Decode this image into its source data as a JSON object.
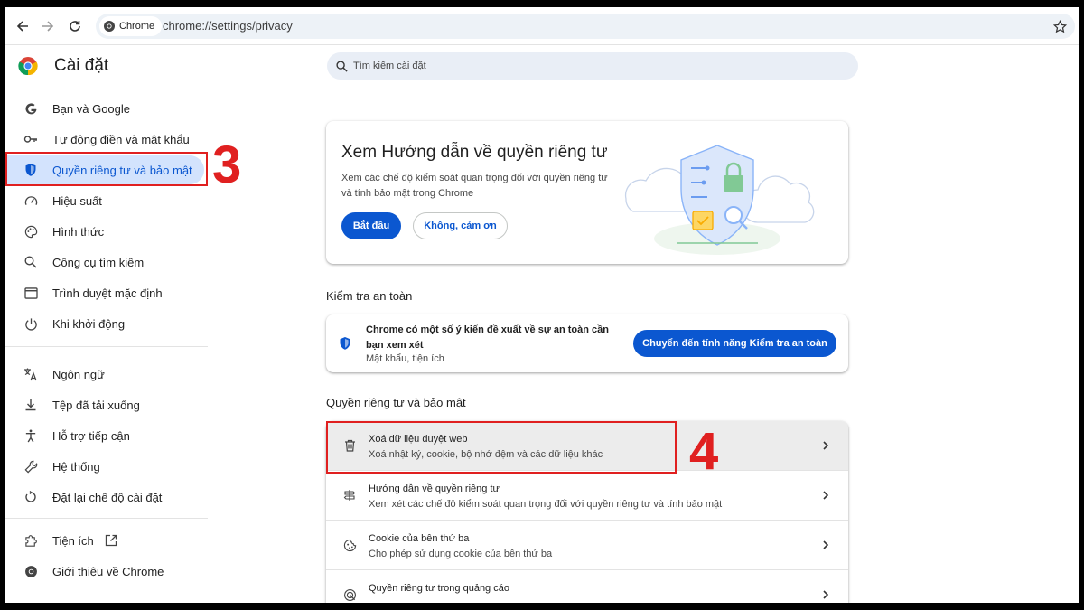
{
  "browser": {
    "chip_label": "Chrome",
    "url": "chrome://settings/privacy"
  },
  "header": {
    "title": "Cài đặt",
    "search_placeholder": "Tìm kiếm cài đặt"
  },
  "sidebar": {
    "items": [
      {
        "label": "Bạn và Google",
        "icon": "google-g-icon"
      },
      {
        "label": "Tự động điền và mật khẩu",
        "icon": "key-icon"
      },
      {
        "label": "Quyền riêng tư và bảo mật",
        "icon": "shield-icon",
        "active": true
      },
      {
        "label": "Hiệu suất",
        "icon": "speedometer-icon"
      },
      {
        "label": "Hình thức",
        "icon": "palette-icon"
      },
      {
        "label": "Công cụ tìm kiếm",
        "icon": "search-icon"
      },
      {
        "label": "Trình duyệt mặc định",
        "icon": "browser-window-icon"
      },
      {
        "label": "Khi khởi động",
        "icon": "power-icon"
      },
      {
        "label": "Ngôn ngữ",
        "icon": "translate-icon"
      },
      {
        "label": "Tệp đã tải xuống",
        "icon": "download-icon"
      },
      {
        "label": "Hỗ trợ tiếp cận",
        "icon": "accessibility-icon"
      },
      {
        "label": "Hệ thống",
        "icon": "wrench-icon"
      },
      {
        "label": "Đặt lại chế độ cài đặt",
        "icon": "reset-icon"
      },
      {
        "label": "Tiện ích",
        "icon": "puzzle-icon"
      },
      {
        "label": "Giới thiệu về Chrome",
        "icon": "chrome-icon"
      }
    ]
  },
  "guide_card": {
    "title": "Xem Hướng dẫn về quyền riêng tư",
    "description": "Xem các chế độ kiểm soát quan trọng đối với quyền riêng tư và tính bảo mật trong Chrome",
    "start_label": "Bắt đầu",
    "no_thanks_label": "Không, cảm ơn"
  },
  "safety": {
    "section_title": "Kiểm tra an toàn",
    "message": "Chrome có một số ý kiến đề xuất về sự an toàn cần bạn xem xét",
    "subtext": "Mật khẩu, tiện ích",
    "button_label": "Chuyển đến tính năng Kiểm tra an toàn"
  },
  "privacy": {
    "section_title": "Quyền riêng tư và bảo mật",
    "rows": [
      {
        "title": "Xoá dữ liệu duyệt web",
        "subtitle": "Xoá nhật ký, cookie, bộ nhớ đệm và các dữ liệu khác",
        "icon": "trash-icon"
      },
      {
        "title": "Hướng dẫn về quyền riêng tư",
        "subtitle": "Xem xét các chế độ kiểm soát quan trọng đối với quyền riêng tư và tính bảo mật",
        "icon": "signpost-icon"
      },
      {
        "title": "Cookie của bên thứ ba",
        "subtitle": "Cho phép sử dụng cookie của bên thứ ba",
        "icon": "cookie-icon"
      },
      {
        "title": "Quyền riêng tư trong quảng cáo",
        "subtitle": "",
        "icon": "ads-target-icon"
      }
    ]
  },
  "annotations": {
    "step_a": "3",
    "step_b": "4"
  },
  "colors": {
    "accent": "#0b57d0",
    "active_bg": "#d3e3fd",
    "annotation_red": "#e02020"
  }
}
